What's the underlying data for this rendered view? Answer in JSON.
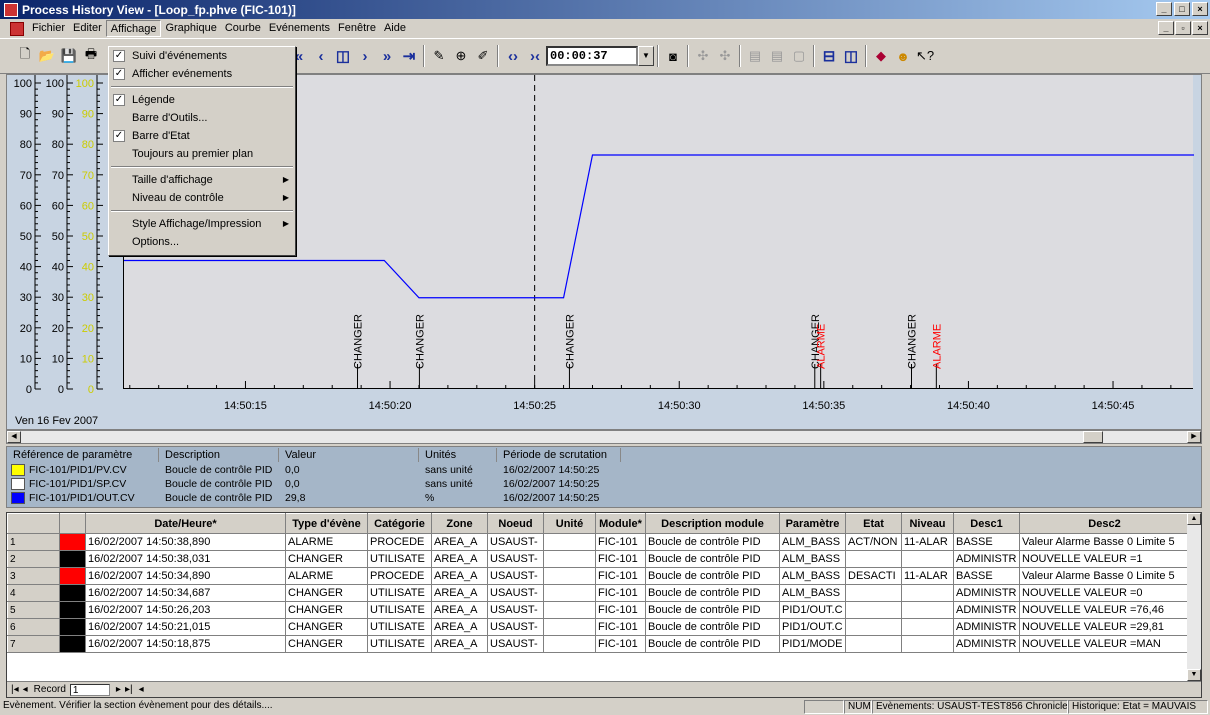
{
  "window": {
    "title": "Process History View - [Loop_fp.phve (FIC-101)]"
  },
  "menubar": [
    "Fichier",
    "Editer",
    "Affichage",
    "Graphique",
    "Courbe",
    "Evénements",
    "Fenêtre",
    "Aide"
  ],
  "toolbar": {
    "time": "00:00:37"
  },
  "affichage_menu": [
    {
      "label": "Suivi d'événements",
      "checked": true
    },
    {
      "label": "Afficher evénements",
      "checked": true
    },
    {
      "sep": true
    },
    {
      "label": "Légende",
      "checked": true
    },
    {
      "label": "Barre d'Outils...",
      "checked": false
    },
    {
      "label": "Barre d'Etat",
      "checked": true
    },
    {
      "label": "Toujours au premier plan",
      "checked": false
    },
    {
      "sep": true
    },
    {
      "label": "Taille d'affichage",
      "checked": false,
      "sub": true
    },
    {
      "label": "Niveau de contrôle",
      "checked": false,
      "sub": true
    },
    {
      "sep": true
    },
    {
      "label": "Style Affichage/Impression",
      "checked": false,
      "sub": true
    },
    {
      "label": "Options...",
      "checked": false
    }
  ],
  "chart": {
    "date_label": "Ven 16 Fev 2007",
    "y_ticks": [
      "0",
      "10",
      "20",
      "30",
      "40",
      "50",
      "60",
      "70",
      "80",
      "90",
      "100"
    ],
    "x_ticks": [
      "14:50:15",
      "14:50:20",
      "14:50:25",
      "14:50:30",
      "14:50:35",
      "14:50:40",
      "14:50:45"
    ],
    "cursor_time": "14:50:25"
  },
  "chart_data": {
    "type": "line",
    "xlabel": "",
    "ylabel": "",
    "ylim": [
      0,
      100
    ],
    "xlim": [
      "14:50:10.8",
      "14:50:47.8"
    ],
    "grid": false,
    "series": [
      {
        "name": "FIC-101/PID1/OUT.CV",
        "color": "#0000ff",
        "x": [
          "14:50:10.8",
          "14:50:19.8",
          "14:50:21.0",
          "14:50:26.0",
          "14:50:27.0",
          "14:50:47.8"
        ],
        "y": [
          42,
          42,
          29.81,
          29.81,
          76.46,
          76.46
        ]
      }
    ],
    "events": [
      {
        "time": "14:50:18.875",
        "label": "CHANGER",
        "color": "#000000"
      },
      {
        "time": "14:50:21.015",
        "label": "CHANGER",
        "color": "#000000"
      },
      {
        "time": "14:50:26.203",
        "label": "CHANGER",
        "color": "#000000"
      },
      {
        "time": "14:50:34.687",
        "label": "CHANGER",
        "color": "#000000"
      },
      {
        "time": "14:50:34.890",
        "label": "ALARME",
        "color": "#ff0000"
      },
      {
        "time": "14:50:38.031",
        "label": "CHANGER",
        "color": "#000000"
      },
      {
        "time": "14:50:38.890",
        "label": "ALARME",
        "color": "#ff0000"
      }
    ]
  },
  "legend": {
    "headers": [
      "Référence de paramètre",
      "Description",
      "Valeur",
      "Unités",
      "Période de scrutation"
    ],
    "rows": [
      {
        "color": "#ffff00",
        "ref": "FIC-101/PID1/PV.CV",
        "desc": "Boucle de contrôle PID",
        "value": "0,0",
        "unit": "sans unité",
        "period": "16/02/2007 14:50:25"
      },
      {
        "color": "#ffffff",
        "ref": "FIC-101/PID1/SP.CV",
        "desc": "Boucle de contrôle PID",
        "value": "0,0",
        "unit": "sans unité",
        "period": "16/02/2007 14:50:25"
      },
      {
        "color": "#0000ff",
        "ref": "FIC-101/PID1/OUT.CV",
        "desc": "Boucle de contrôle PID",
        "value": "29,8",
        "unit": "%",
        "period": "16/02/2007 14:50:25"
      }
    ]
  },
  "events_table": {
    "headers": [
      "",
      "",
      "Date/Heure*",
      "Type d'évène",
      "Catégorie",
      "Zone",
      "Noeud",
      "Unité",
      "Module*",
      "Description module",
      "Paramètre",
      "Etat",
      "Niveau",
      "Desc1",
      "Desc2"
    ],
    "rows": [
      {
        "n": "1",
        "color": "#ff0000",
        "cells": [
          "16/02/2007 14:50:38,890",
          "ALARME",
          "PROCEDE",
          "AREA_A",
          "USAUST-",
          "",
          "FIC-101",
          "Boucle de contrôle PID",
          "ALM_BASS",
          "ACT/NON",
          "11-ALAR",
          "BASSE",
          "Valeur Alarme Basse 0 Limite 5"
        ]
      },
      {
        "n": "2",
        "color": "#000000",
        "cells": [
          "16/02/2007 14:50:38,031",
          "CHANGER",
          "UTILISATE",
          "AREA_A",
          "USAUST-",
          "",
          "FIC-101",
          "Boucle de contrôle PID",
          "ALM_BASS",
          "",
          "",
          "ADMINISTR",
          "NOUVELLE VALEUR =1"
        ]
      },
      {
        "n": "3",
        "color": "#ff0000",
        "cells": [
          "16/02/2007 14:50:34,890",
          "ALARME",
          "PROCEDE",
          "AREA_A",
          "USAUST-",
          "",
          "FIC-101",
          "Boucle de contrôle PID",
          "ALM_BASS",
          "DESACTI",
          "11-ALAR",
          "BASSE",
          "Valeur Alarme Basse 0 Limite 5"
        ]
      },
      {
        "n": "4",
        "color": "#000000",
        "cells": [
          "16/02/2007 14:50:34,687",
          "CHANGER",
          "UTILISATE",
          "AREA_A",
          "USAUST-",
          "",
          "FIC-101",
          "Boucle de contrôle PID",
          "ALM_BASS",
          "",
          "",
          "ADMINISTR",
          "NOUVELLE VALEUR =0"
        ]
      },
      {
        "n": "5",
        "color": "#000000",
        "cells": [
          "16/02/2007 14:50:26,203",
          "CHANGER",
          "UTILISATE",
          "AREA_A",
          "USAUST-",
          "",
          "FIC-101",
          "Boucle de contrôle PID",
          "PID1/OUT.C",
          "",
          "",
          "ADMINISTR",
          "NOUVELLE VALEUR =76,46"
        ]
      },
      {
        "n": "6",
        "color": "#000000",
        "cells": [
          "16/02/2007 14:50:21,015",
          "CHANGER",
          "UTILISATE",
          "AREA_A",
          "USAUST-",
          "",
          "FIC-101",
          "Boucle de contrôle PID",
          "PID1/OUT.C",
          "",
          "",
          "ADMINISTR",
          "NOUVELLE VALEUR =29,81"
        ]
      },
      {
        "n": "7",
        "color": "#000000",
        "cells": [
          "16/02/2007 14:50:18,875",
          "CHANGER",
          "UTILISATE",
          "AREA_A",
          "USAUST-",
          "",
          "FIC-101",
          "Boucle de contrôle PID",
          "PID1/MODE",
          "",
          "",
          "ADMINISTR",
          "NOUVELLE VALEUR =MAN"
        ]
      }
    ],
    "record_label": "Record",
    "record_value": "1"
  },
  "status": {
    "message": "Evènement. Vérifier la section évènement pour des détails....",
    "num": "NUM",
    "events": "Evènements: USAUST-TEST856 Chronicle",
    "history": "Historique:  Etat = MAUVAIS"
  }
}
